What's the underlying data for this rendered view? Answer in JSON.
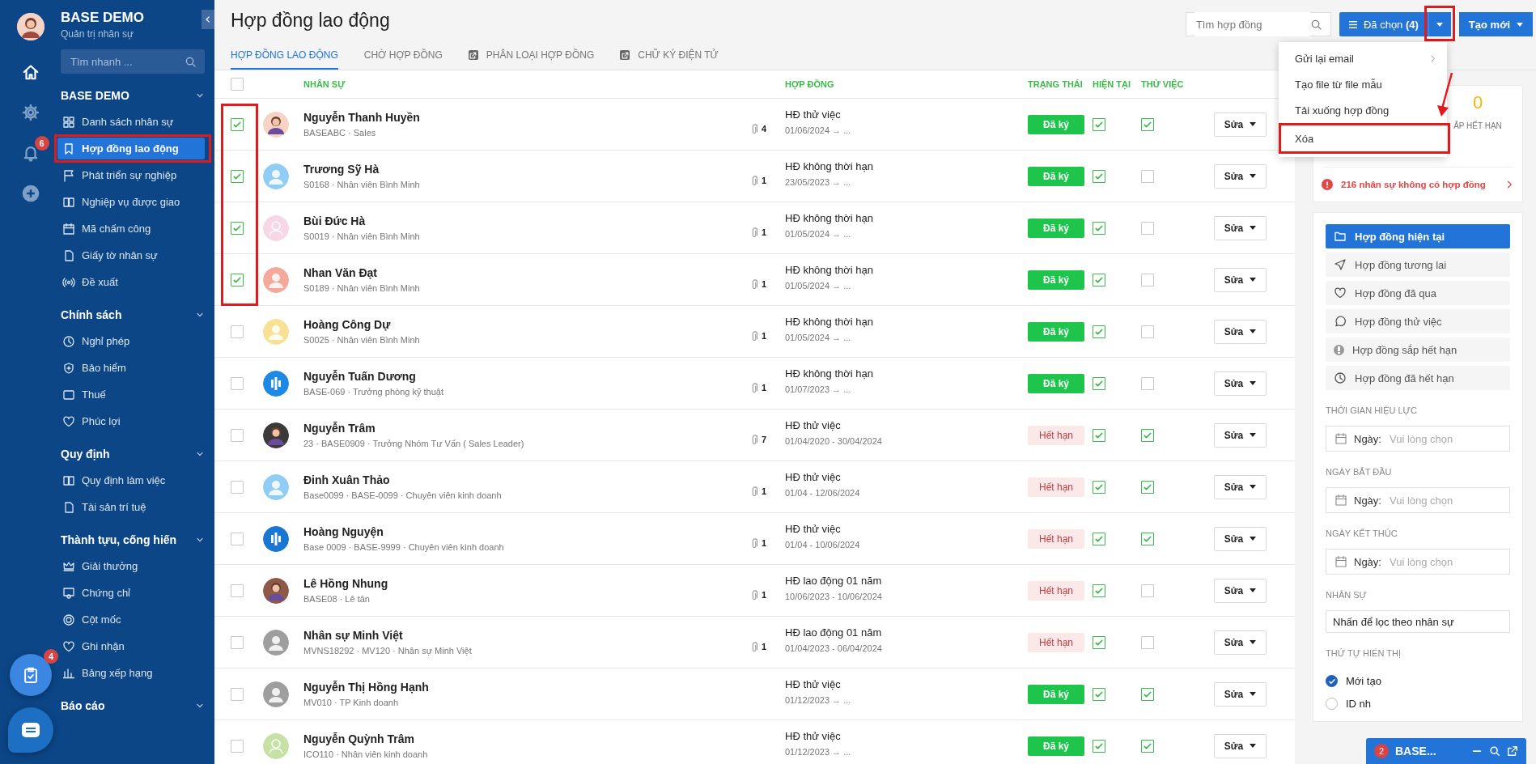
{
  "sidebar": {
    "notifications_badge": "6",
    "brand": {
      "title": "BASE DEMO",
      "subtitle": "Quản trị nhân sự"
    },
    "search": {
      "placeholder": "Tìm nhanh ..."
    },
    "groups": [
      {
        "title": "BASE DEMO",
        "expanded": true,
        "items": [
          {
            "label": "Danh sách nhân sự",
            "selected": false,
            "annotated": false
          },
          {
            "label": "Hợp đồng lao động",
            "selected": true,
            "annotated": true
          },
          {
            "label": "Phát triển sự nghiệp",
            "selected": false,
            "annotated": false
          },
          {
            "label": "Nghiệp vụ được giao",
            "selected": false,
            "annotated": false
          },
          {
            "label": "Mã chấm công",
            "selected": false,
            "annotated": false
          },
          {
            "label": "Giấy tờ nhân sự",
            "selected": false,
            "annotated": false
          },
          {
            "label": "Đề xuất",
            "selected": false,
            "annotated": false
          }
        ]
      },
      {
        "title": "Chính sách",
        "expanded": true,
        "items": [
          {
            "label": "Nghỉ phép",
            "selected": false,
            "annotated": false
          },
          {
            "label": "Bảo hiểm",
            "selected": false,
            "annotated": false
          },
          {
            "label": "Thuế",
            "selected": false,
            "annotated": false
          },
          {
            "label": "Phúc lợi",
            "selected": false,
            "annotated": false
          }
        ]
      },
      {
        "title": "Quy định",
        "expanded": true,
        "items": [
          {
            "label": "Quy định làm việc",
            "selected": false,
            "annotated": false
          },
          {
            "label": "Tài sản trí tuệ",
            "selected": false,
            "annotated": false
          }
        ]
      },
      {
        "title": "Thành tựu, cống hiến",
        "expanded": true,
        "items": [
          {
            "label": "Giải thưởng",
            "selected": false,
            "annotated": false
          },
          {
            "label": "Chứng chỉ",
            "selected": false,
            "annotated": false
          },
          {
            "label": "Cột mốc",
            "selected": false,
            "annotated": false
          },
          {
            "label": "Ghi nhận",
            "selected": false,
            "annotated": false
          },
          {
            "label": "Bảng xếp hạng",
            "selected": false,
            "annotated": false
          }
        ]
      },
      {
        "title": "Báo cáo",
        "expanded": true
      }
    ]
  },
  "floating": {
    "tasks_badge": "4"
  },
  "page": {
    "title": "Hợp đồng lao động",
    "search": {
      "placeholder": "Tìm hợp đồng"
    },
    "selected_button": "Đã chọn **(4)**",
    "caret_annotated": true,
    "create_button": "Tạo mới"
  },
  "tabs": [
    {
      "label": "HỢP ĐỒNG LAO ĐỘNG",
      "selected": true,
      "kind": "plain"
    },
    {
      "label": "CHỜ HỢP ĐỒNG",
      "selected": false,
      "kind": "plain"
    },
    {
      "label": "PHÂN LOẠI HỢP ĐỒNG",
      "selected": false,
      "kind": "link"
    },
    {
      "label": "CHỮ KÝ ĐIỆN TỬ",
      "selected": false,
      "kind": "link"
    }
  ],
  "table": {
    "select_all": {
      "checked": false
    },
    "columns": [
      "NHÂN SỰ",
      "HỢP ĐỒNG",
      "TRẠNG THÁI",
      "HIỆN TẠI",
      "THỬ VIỆC"
    ],
    "rows": [
      {
        "checked": true,
        "annotated": true,
        "avatar": {
          "kind": "photo",
          "color": "#f6d3c4"
        },
        "name": "Nguyễn Thanh Huyền",
        "detail": "BASEABC · Sales",
        "attachments": "4",
        "contract": "HĐ thử việc",
        "period": "01/06/2024 → ...",
        "status": {
          "kind": "signed",
          "label": "Đã ký"
        },
        "current": true,
        "trial": true,
        "edit": "Sửa"
      },
      {
        "checked": true,
        "annotated": true,
        "avatar": {
          "kind": "silhouette",
          "color": "#90cdf4"
        },
        "name": "Trương Sỹ Hà",
        "detail": "S0168 · Nhân viên Bình Minh",
        "attachments": "1",
        "contract": "HĐ không thời hạn",
        "period": "23/05/2023 → ...",
        "status": {
          "kind": "signed",
          "label": "Đã ký"
        },
        "current": true,
        "trial": false,
        "edit": "Sửa"
      },
      {
        "checked": true,
        "annotated": true,
        "avatar": {
          "kind": "outline",
          "color": "#f7d6e6"
        },
        "name": "Bùi Đức Hà",
        "detail": "S0019 · Nhân viên Bình Minh",
        "attachments": "1",
        "contract": "HĐ không thời hạn",
        "period": "01/05/2024 → ...",
        "status": {
          "kind": "signed",
          "label": "Đã ký"
        },
        "current": true,
        "trial": false,
        "edit": "Sửa"
      },
      {
        "checked": true,
        "annotated": true,
        "avatar": {
          "kind": "silhouette",
          "color": "#f5a99a"
        },
        "name": "Nhan Văn Đạt",
        "detail": "S0189 · Nhân viên Bình Minh",
        "attachments": "1",
        "contract": "HĐ không thời hạn",
        "period": "01/05/2024 → ...",
        "status": {
          "kind": "signed",
          "label": "Đã ký"
        },
        "current": true,
        "trial": false,
        "edit": "Sửa"
      },
      {
        "checked": false,
        "annotated": false,
        "avatar": {
          "kind": "silhouette",
          "color": "#f7e194"
        },
        "name": "Hoàng Công Dự",
        "detail": "S0025 · Nhân viên Bình Minh",
        "attachments": "1",
        "contract": "HĐ không thời hạn",
        "period": "01/05/2024 → ...",
        "status": {
          "kind": "signed",
          "label": "Đã ký"
        },
        "current": true,
        "trial": false,
        "edit": "Sửa"
      },
      {
        "checked": false,
        "annotated": false,
        "avatar": {
          "kind": "logo",
          "color": "#1e88e5"
        },
        "name": "Nguyễn Tuấn Dương",
        "detail": "BASE-069 · Trưởng phòng kỹ thuật",
        "attachments": "1",
        "contract": "HĐ không thời hạn",
        "period": "01/07/2023 → ...",
        "status": {
          "kind": "signed",
          "label": "Đã ký"
        },
        "current": true,
        "trial": false,
        "edit": "Sửa"
      },
      {
        "checked": false,
        "annotated": false,
        "avatar": {
          "kind": "photo",
          "color": "#3a3a3a"
        },
        "name": "Nguyễn Trâm",
        "detail": "23 · BASE0909 · Trưởng Nhóm Tư Vấn ( Sales Leader)",
        "attachments": "7",
        "contract": "HĐ thử việc",
        "period": "01/04/2020 - 30/04/2024",
        "status": {
          "kind": "expired",
          "label": "Hết hạn"
        },
        "current": true,
        "trial": true,
        "edit": "Sửa"
      },
      {
        "checked": false,
        "annotated": false,
        "avatar": {
          "kind": "silhouette",
          "color": "#90cdf4"
        },
        "name": "Đinh Xuân Thảo",
        "detail": "Base0099 · BASE-0099 · Chuyên viên kinh doanh",
        "attachments": "1",
        "contract": "HĐ thử việc",
        "period": "01/04 - 12/06/2024",
        "status": {
          "kind": "expired",
          "label": "Hết hạn"
        },
        "current": true,
        "trial": true,
        "edit": "Sửa"
      },
      {
        "checked": false,
        "annotated": false,
        "avatar": {
          "kind": "logo",
          "color": "#1976d2"
        },
        "name": "Hoàng Nguyện",
        "detail": "Base 0009 · BASE-9999 · Chuyên viên kinh doanh",
        "attachments": "1",
        "contract": "HĐ thử việc",
        "period": "01/04 - 10/06/2024",
        "status": {
          "kind": "expired",
          "label": "Hết hạn"
        },
        "current": true,
        "trial": true,
        "edit": "Sửa"
      },
      {
        "checked": false,
        "annotated": false,
        "avatar": {
          "kind": "photo",
          "color": "#8d5a4a"
        },
        "name": "Lê Hồng Nhung",
        "detail": "BASE08 · Lê tân",
        "attachments": "1",
        "contract": "HĐ lao động 01 năm",
        "period": "10/06/2023 - 10/06/2024",
        "status": {
          "kind": "expired",
          "label": "Hết hạn"
        },
        "current": true,
        "trial": false,
        "edit": "Sửa"
      },
      {
        "checked": false,
        "annotated": false,
        "avatar": {
          "kind": "silhouette",
          "color": "#9e9e9e"
        },
        "name": "Nhân sự Minh Việt",
        "detail": "MVNS18292 · MV120 · Nhân sự Minh Việt",
        "attachments": "1",
        "contract": "HĐ lao động 01 năm",
        "period": "01/04/2023 - 06/04/2024",
        "status": {
          "kind": "expired",
          "label": "Hết hạn"
        },
        "current": true,
        "trial": false,
        "edit": "Sửa"
      },
      {
        "checked": false,
        "annotated": false,
        "avatar": {
          "kind": "silhouette",
          "color": "#9e9e9e"
        },
        "name": "Nguyễn Thị Hồng Hạnh",
        "detail": "MV010 · TP Kinh doanh",
        "contract": "HĐ thử việc",
        "period": "01/12/2023 → ...",
        "status": {
          "kind": "signed",
          "label": "Đã ký"
        },
        "current": true,
        "trial": true,
        "edit": "Sửa"
      },
      {
        "checked": false,
        "annotated": false,
        "avatar": {
          "kind": "outline",
          "color": "#c5e1a5"
        },
        "name": "Nguyễn Quỳnh Trâm",
        "detail": "ICO110 · Nhân viên kinh doanh",
        "contract": "HĐ thử việc",
        "period": "01/12/2023 → ...",
        "status": {
          "kind": "signed",
          "label": "Đã ký"
        },
        "current": true,
        "trial": true,
        "edit": "Sửa"
      }
    ]
  },
  "menu": {
    "items": [
      {
        "label": "Gửi lại email",
        "submenu": true,
        "annotated": false
      },
      {
        "label": "Tạo file từ file mẫu",
        "submenu": false,
        "annotated": false
      },
      {
        "label": "Tải xuống hợp đồng",
        "submenu": false,
        "annotated": false
      },
      {
        "label": "Xóa",
        "submenu": false,
        "annotated": true
      }
    ]
  },
  "summary": {
    "stat_value": "0",
    "stat_label": "ẮP HẾT HẠN",
    "warning": "216 nhân sự không có hợp đồng"
  },
  "filters": [
    {
      "label": "Hợp đồng hiện tại",
      "selected": true
    },
    {
      "label": "Hợp đồng tương lai",
      "selected": false
    },
    {
      "label": "Hợp đồng đã qua",
      "selected": false
    },
    {
      "label": "Hợp đồng thử việc",
      "selected": false
    },
    {
      "label": "Hợp đồng sắp hết hạn",
      "selected": false
    },
    {
      "label": "Hợp đồng đã hết hạn",
      "selected": false
    }
  ],
  "date_filters": [
    {
      "label": "THỜI GIAN HIỆU LỰC",
      "prefix": "Ngày:",
      "placeholder": "Vui lòng chọn"
    },
    {
      "label": "NGÀY BẮT ĐẦU",
      "prefix": "Ngày:",
      "placeholder": "Vui lòng chọn"
    },
    {
      "label": "NGÀY KẾT THÚC",
      "prefix": "Ngày:",
      "placeholder": "Vui lòng chọn"
    }
  ],
  "staff_filter": {
    "label": "NHÂN SỰ",
    "value": "Nhấn để lọc theo nhân sự"
  },
  "sort": {
    "label": "THỨ TỰ HIỂN THỊ",
    "options": [
      {
        "label": "Mới tạo",
        "selected": true
      },
      {
        "label": "ID nh",
        "selected": false
      }
    ]
  },
  "chat_widget": {
    "badge": "2",
    "title": "BASE..."
  }
}
